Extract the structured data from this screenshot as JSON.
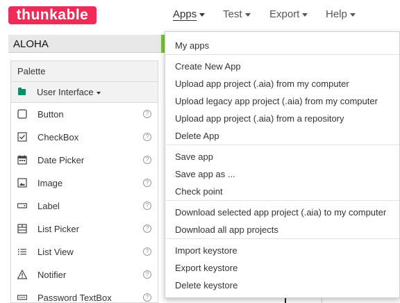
{
  "logo": "thunkable",
  "nav": {
    "apps": "Apps",
    "test": "Test",
    "export": "Export",
    "help": "Help"
  },
  "project": {
    "name": "ALOHA"
  },
  "palette": {
    "title": "Palette",
    "category": "User Interface",
    "components": [
      {
        "label": "Button",
        "icon": "button-icon"
      },
      {
        "label": "CheckBox",
        "icon": "checkbox-icon"
      },
      {
        "label": "Date Picker",
        "icon": "calendar-icon"
      },
      {
        "label": "Image",
        "icon": "image-icon"
      },
      {
        "label": "Label",
        "icon": "label-icon"
      },
      {
        "label": "List Picker",
        "icon": "list-picker-icon"
      },
      {
        "label": "List View",
        "icon": "list-view-icon"
      },
      {
        "label": "Notifier",
        "icon": "warning-icon"
      },
      {
        "label": "Password TextBox",
        "icon": "password-icon"
      }
    ],
    "help_glyph": "?"
  },
  "apps_menu": {
    "items": [
      "My apps",
      "Create New App",
      "Upload app project (.aia) from my computer",
      "Upload legacy app project (.aia) from my computer",
      "Upload app project (.aia) from a repository",
      "Delete App",
      "Save app",
      "Save app as ...",
      "Check point",
      "Download selected app project (.aia) to my computer",
      "Download all app projects",
      "Import keystore",
      "Export keystore",
      "Delete keystore"
    ]
  },
  "colors": {
    "brand": "#f02b5a",
    "accent_green": "#7bc143",
    "folder_green": "#0f8d6b"
  }
}
